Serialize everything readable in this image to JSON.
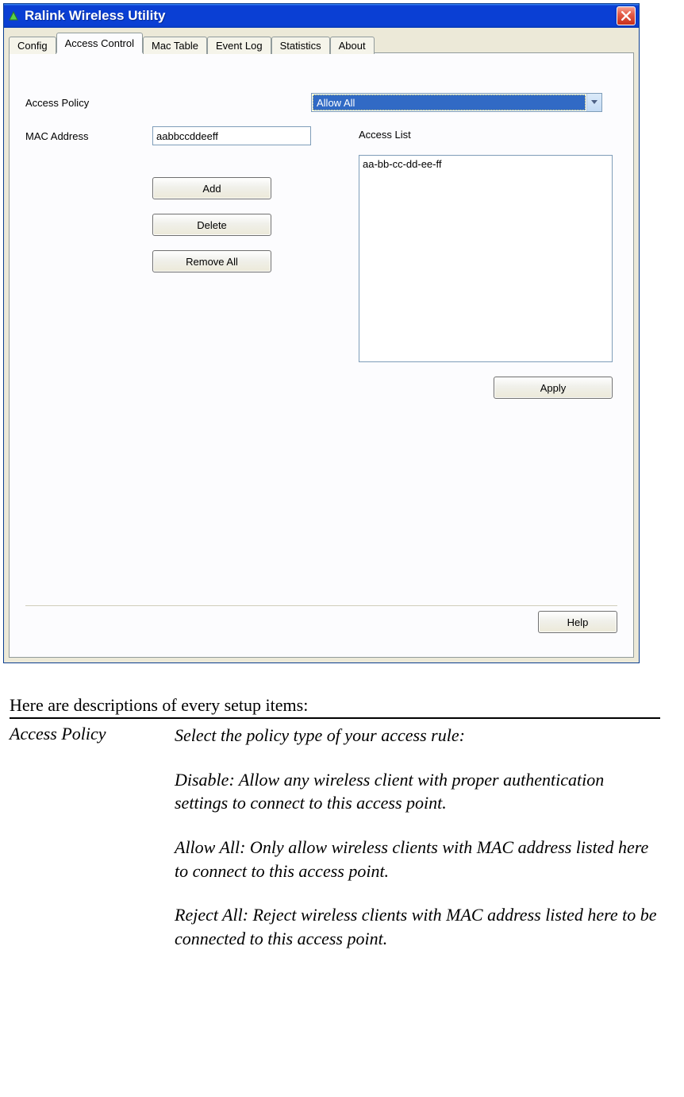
{
  "window": {
    "title": "Ralink Wireless Utility"
  },
  "tabs": {
    "config": "Config",
    "access_control": "Access Control",
    "mac_table": "Mac Table",
    "event_log": "Event Log",
    "statistics": "Statistics",
    "about": "About"
  },
  "labels": {
    "access_policy": "Access Policy",
    "mac_address": "MAC Address",
    "access_list": "Access List"
  },
  "fields": {
    "policy_value": "Allow All",
    "mac_value": "aabbccddeeff"
  },
  "buttons": {
    "add": "Add",
    "delete": "Delete",
    "remove_all": "Remove All",
    "apply": "Apply",
    "help": "Help"
  },
  "access_list": {
    "items": [
      "aa-bb-cc-dd-ee-ff"
    ]
  },
  "description": {
    "intro": "Here are descriptions of every setup items:",
    "item_label": "Access Policy",
    "p1": "Select the policy type of your access rule:",
    "p2": "Disable: Allow any wireless client with proper authentication settings to connect to this access point.",
    "p3": "Allow All: Only allow wireless clients with MAC address listed here to connect to this access point.",
    "p4": "Reject All: Reject wireless clients with MAC address listed here to be connected to this access point."
  }
}
